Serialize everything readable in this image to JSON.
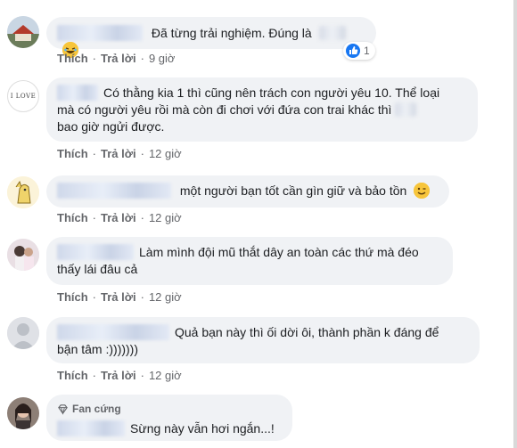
{
  "actions": {
    "like": "Thích",
    "reply": "Trả lời",
    "separator": "·"
  },
  "comments": [
    {
      "text": "Đã từng trải nghiệm. Đúng là",
      "time": "9 giờ",
      "reaction_count": "1",
      "reaction_icons": [
        "like-icon",
        "laugh-icon"
      ]
    },
    {
      "text_line1": "Có thằng kia 1 thì cũng nên trách con người yêu 10. Thể loại",
      "text_line2": "mà có người yêu rồi mà còn đi chơi với đứa con trai khác thì",
      "text_line3": "bao giờ ngửi được.",
      "avatar_text": "I LOVE",
      "time": "12 giờ"
    },
    {
      "text": "một người bạn tốt cần gìn giữ và bảo tồn",
      "time": "12 giờ"
    },
    {
      "text_line1": "Làm mình đội mũ thắt dây an toàn các thứ mà đéo",
      "text_line2": "thấy lái đâu cả",
      "time": "12 giờ"
    },
    {
      "text_line1": "Quả bạn này thì ối dời ôi, thành phần k đáng để",
      "text_line2": "bận tâm :)))))))",
      "time": "12 giờ"
    },
    {
      "badge": "Fan cứng",
      "text": "Sừng này vẫn hơi ngắn...!"
    }
  ],
  "colors": {
    "bubble": "#f0f2f5",
    "meta": "#65676b",
    "text": "#1c1e21",
    "like_blue": "#1877f2"
  }
}
